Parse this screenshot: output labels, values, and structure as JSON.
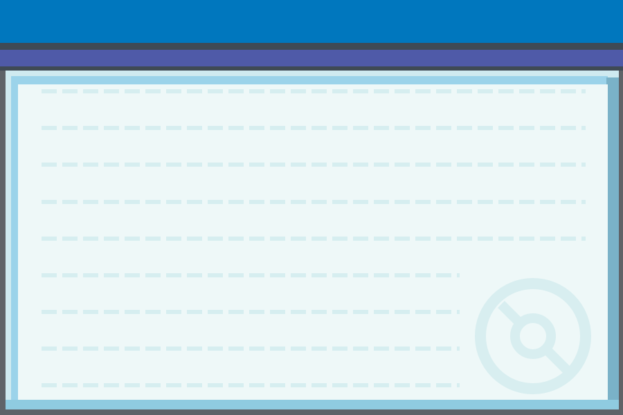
{
  "screen": {
    "type": "message_box",
    "lines": [
      "",
      "",
      "",
      "",
      "",
      "",
      "",
      "",
      ""
    ],
    "emblem": "pokeball-icon"
  },
  "colors": {
    "banner": "#0077be",
    "title_bar": "#4f5aa8",
    "frame_border": "#9bd3ea",
    "text_area": "#eef8f8",
    "guide_lines": "#d6eef0"
  }
}
